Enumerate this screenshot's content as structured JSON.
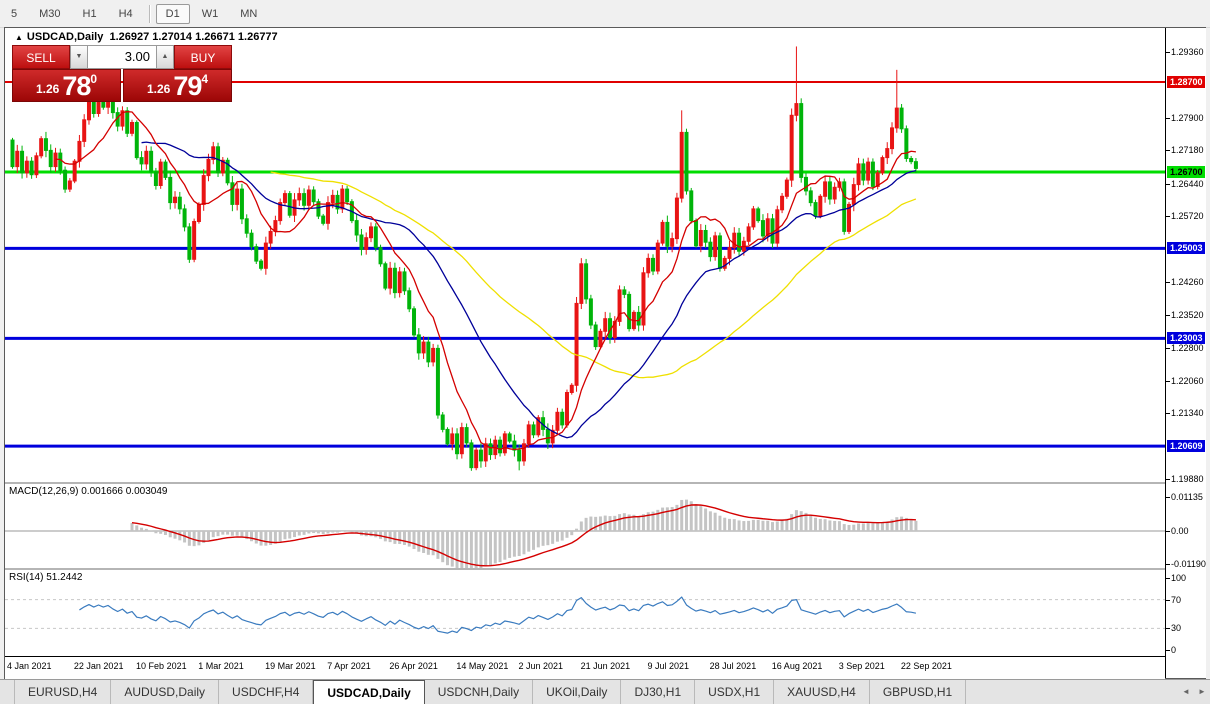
{
  "toolbar": {
    "timeframes": [
      "5",
      "M30",
      "H1",
      "H4",
      "D1",
      "W1",
      "MN"
    ],
    "active": "D1",
    "separator_after": "H4"
  },
  "chart": {
    "title_icon": "▲",
    "title": "USDCAD,Daily",
    "ohlc_line": "1.26927 1.27014 1.26671 1.26777"
  },
  "trade_panel": {
    "sell_label": "SELL",
    "buy_label": "BUY",
    "volume": "3.00",
    "spinner_down_icon": "▼",
    "spinner_up_icon": "▲",
    "sell_price_small": "1.26",
    "sell_price_big": "78",
    "sell_price_sup": "0",
    "buy_price_small": "1.26",
    "buy_price_big": "79",
    "buy_price_sup": "4"
  },
  "chart_data": {
    "type": "candlestick",
    "symbol": "USDCAD",
    "timeframe": "Daily",
    "current_ohlc": {
      "open": "1.26927",
      "high": "1.27014",
      "low": "1.26671",
      "close": "1.26777"
    },
    "first_open": 1.2741,
    "closes": [
      1.2682,
      1.2716,
      1.2668,
      1.2694,
      1.2664,
      1.2706,
      1.2744,
      1.2718,
      1.2682,
      1.2712,
      1.2674,
      1.2632,
      1.265,
      1.2694,
      1.2738,
      1.2786,
      1.2828,
      1.28,
      1.2836,
      1.2814,
      1.284,
      1.2802,
      1.2772,
      1.2806,
      1.2756,
      1.278,
      1.2702,
      1.2688,
      1.2716,
      1.267,
      1.264,
      1.2692,
      1.2658,
      1.2602,
      1.2614,
      1.2588,
      1.2548,
      1.2476,
      1.256,
      1.2598,
      1.2662,
      1.2698,
      1.2726,
      1.2668,
      1.2696,
      1.2646,
      1.2598,
      1.2632,
      1.2566,
      1.2534,
      1.2504,
      1.2472,
      1.2456,
      1.2512,
      1.2538,
      1.2562,
      1.2602,
      1.2622,
      1.2574,
      1.2608,
      1.2622,
      1.2596,
      1.263,
      1.2604,
      1.2572,
      1.2556,
      1.2602,
      1.2618,
      1.2588,
      1.2632,
      1.2604,
      1.2562,
      1.253,
      1.2498,
      1.2524,
      1.2548,
      1.2502,
      1.2466,
      1.2412,
      1.2456,
      1.2402,
      1.2448,
      1.2406,
      1.2366,
      1.2308,
      1.2268,
      1.2292,
      1.2248,
      1.2278,
      1.213,
      1.2098,
      1.2066,
      1.2088,
      1.2044,
      1.2102,
      1.2068,
      1.2013,
      1.2052,
      1.2028,
      1.2066,
      1.2042,
      1.2074,
      1.2046,
      1.2088,
      1.2072,
      1.2052,
      1.2028,
      1.2066,
      1.2108,
      1.2086,
      1.2124,
      1.2098,
      1.2068,
      1.2096,
      1.2136,
      1.2108,
      1.218,
      1.2196,
      1.2378,
      1.2466,
      1.2388,
      1.233,
      1.2282,
      1.2316,
      1.2344,
      1.2302,
      1.2338,
      1.2408,
      1.2398,
      1.2322,
      1.2358,
      1.233,
      1.2446,
      1.2478,
      1.245,
      1.2512,
      1.2558,
      1.2505,
      1.2522,
      1.2612,
      1.2758,
      1.2628,
      1.2562,
      1.2506,
      1.254,
      1.2514,
      1.2482,
      1.2528,
      1.2456,
      1.2478,
      1.2502,
      1.2534,
      1.2494,
      1.2516,
      1.2548,
      1.2588,
      1.2562,
      1.2528,
      1.2566,
      1.2512,
      1.2586,
      1.2616,
      1.2652,
      1.2796,
      1.2822,
      1.2658,
      1.2628,
      1.2602,
      1.2572,
      1.2616,
      1.2648,
      1.261,
      1.2636,
      1.2648,
      1.2538,
      1.2598,
      1.2642,
      1.2688,
      1.2652,
      1.2692,
      1.2638,
      1.2668,
      1.2702,
      1.2722,
      1.2768,
      1.2812,
      1.2766,
      1.27,
      1.2693,
      1.2678
    ],
    "wick_overrides": [
      {
        "i": 37,
        "low": 1.2468
      },
      {
        "i": 96,
        "low": 1.2006
      },
      {
        "i": 106,
        "low": 1.2007
      },
      {
        "i": 140,
        "high": 1.2807
      },
      {
        "i": 164,
        "high": 1.2949
      },
      {
        "i": 185,
        "high": 1.2897
      },
      {
        "i": 189,
        "high": 1.2701,
        "low": 1.2667
      }
    ],
    "colors": {
      "up": "#e81414",
      "down": "#00b40a",
      "ma_fast": "#d40000",
      "ma_mid": "#000099",
      "ma_slow": "#efe000",
      "macd_hist": "#c4c4c4",
      "macd_signal": "#d40000",
      "rsi_line": "#3a7bbf",
      "level_dashed": "#c8c8c8"
    },
    "moving_averages": [
      {
        "period": 55,
        "color_key": "ma_slow"
      },
      {
        "period": 28,
        "color_key": "ma_mid"
      },
      {
        "period": 10,
        "color_key": "ma_fast"
      }
    ],
    "hlines": [
      {
        "price": 1.287,
        "label": "1.28700",
        "color": "#e00000",
        "badge_bg": "#e00000",
        "badge_fg": "#ffffff",
        "thickness": 2
      },
      {
        "price": 1.267,
        "label": "1.26700",
        "color": "#00dd00",
        "badge_bg": "#00dd00",
        "badge_fg": "#000000",
        "thickness": 3
      },
      {
        "price": 1.25003,
        "label": "1.25003",
        "color": "#0000dd",
        "badge_bg": "#0000dd",
        "badge_fg": "#ffffff",
        "thickness": 3
      },
      {
        "price": 1.23003,
        "label": "1.23003",
        "color": "#0000dd",
        "badge_bg": "#0000dd",
        "badge_fg": "#ffffff",
        "thickness": 3
      },
      {
        "price": 1.20609,
        "label": "1.20609",
        "color": "#0000dd",
        "badge_bg": "#0000dd",
        "badge_fg": "#ffffff",
        "thickness": 3
      }
    ],
    "price_axis_labels": [
      "1.29360",
      "1.27900",
      "1.27180",
      "1.26440",
      "1.25720",
      "1.24260",
      "1.23520",
      "1.22800",
      "1.22060",
      "1.21340",
      "1.19880"
    ],
    "date_axis": [
      {
        "i": 0,
        "label": "4 Jan 2021"
      },
      {
        "i": 14,
        "label": "22 Jan 2021"
      },
      {
        "i": 27,
        "label": "10 Feb 2021"
      },
      {
        "i": 40,
        "label": "1 Mar 2021"
      },
      {
        "i": 54,
        "label": "19 Mar 2021"
      },
      {
        "i": 67,
        "label": "7 Apr 2021"
      },
      {
        "i": 80,
        "label": "26 Apr 2021"
      },
      {
        "i": 94,
        "label": "14 May 2021"
      },
      {
        "i": 107,
        "label": "2 Jun 2021"
      },
      {
        "i": 120,
        "label": "21 Jun 2021"
      },
      {
        "i": 134,
        "label": "9 Jul 2021"
      },
      {
        "i": 147,
        "label": "28 Jul 2021"
      },
      {
        "i": 160,
        "label": "16 Aug 2021"
      },
      {
        "i": 174,
        "label": "3 Sep 2021"
      },
      {
        "i": 187,
        "label": "22 Sep 2021"
      }
    ],
    "macd": {
      "label": "MACD(12,26,9)",
      "values": "0.001666 0.003049",
      "fast": 12,
      "slow": 26,
      "signal": 9,
      "axis": [
        "0.01135",
        "0.00",
        "-0.01190"
      ]
    },
    "rsi": {
      "label": "RSI(14)",
      "value": "51.2442",
      "period": 14,
      "axis": [
        "100",
        "70",
        "30",
        "0"
      ],
      "levels": [
        70,
        30
      ]
    }
  },
  "tabs": {
    "items": [
      "EURUSD,H4",
      "AUDUSD,Daily",
      "USDCHF,H4",
      "USDCAD,Daily",
      "USDCNH,Daily",
      "UKOil,Daily",
      "DJ30,H1",
      "USDX,H1",
      "XAUUSD,H4",
      "GBPUSD,H1"
    ],
    "active_index": 3,
    "left_icon": "◄",
    "right_icon": "►"
  }
}
